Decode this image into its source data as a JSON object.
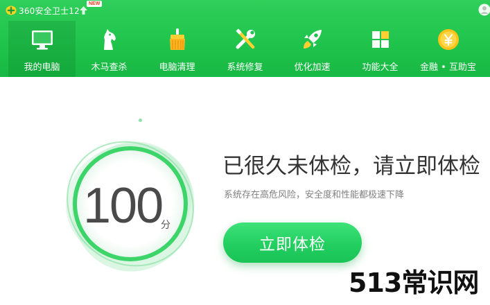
{
  "window": {
    "title": "360安全卫士12",
    "new_badge": "NEW"
  },
  "nav": {
    "items": [
      {
        "label": "我的电脑",
        "icon": "monitor-icon",
        "active": true
      },
      {
        "label": "木马查杀",
        "icon": "horse-icon",
        "active": false
      },
      {
        "label": "电脑清理",
        "icon": "broom-icon",
        "active": false
      },
      {
        "label": "系统修复",
        "icon": "wrench-icon",
        "active": false
      },
      {
        "label": "优化加速",
        "icon": "rocket-icon",
        "active": false
      },
      {
        "label": "功能大全",
        "icon": "grid-icon",
        "active": false
      },
      {
        "label": "金融 • 互助宝",
        "icon": "yuan-coin-icon",
        "active": false
      }
    ]
  },
  "main": {
    "score": "100",
    "score_unit": "分",
    "headline": "已很久未体检，请立即体检",
    "subline": "系统存在高危风险，安全度和性能都极速下降",
    "button_label": "立即体检"
  },
  "watermark": "513常识网",
  "colors": {
    "header_green": "#1fc34b",
    "accent_green": "#22cf5f",
    "ring_green": "#3dd56a"
  }
}
